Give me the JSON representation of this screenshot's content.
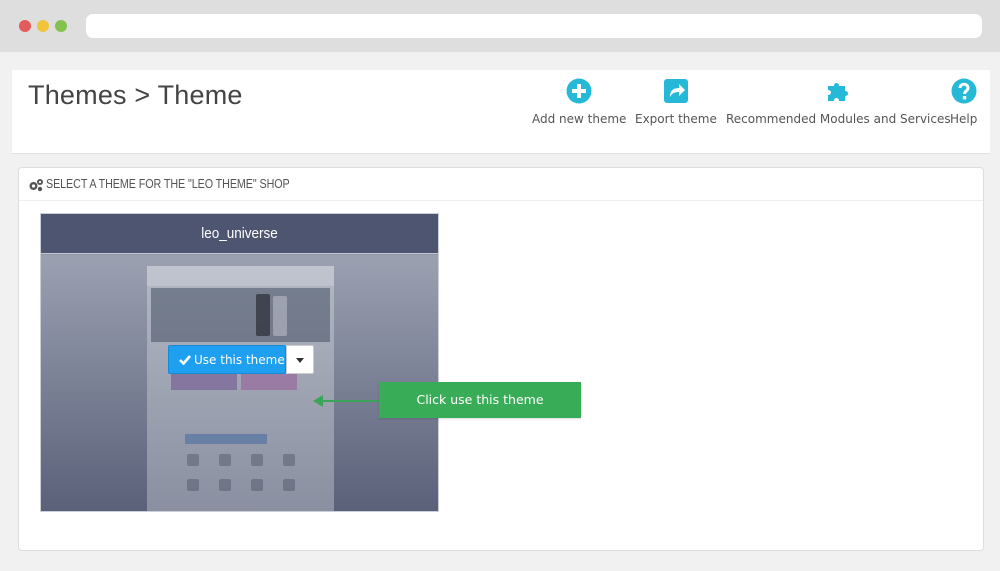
{
  "page": {
    "title": "Themes > Theme"
  },
  "toolbar": {
    "add_new_theme": "Add new theme",
    "export_theme": "Export theme",
    "recommended": "Recommended Modules and Services",
    "help": "Help"
  },
  "panel": {
    "heading": "SELECT A THEME FOR THE \"LEO THEME\" SHOP"
  },
  "theme_card": {
    "name": "leo_universe",
    "use_button_label": "Use this theme"
  },
  "annotation": {
    "callout_text": "Click use this theme"
  },
  "colors": {
    "accent_blue": "#25b9d7",
    "button_blue": "#1f9ff0",
    "callout_green": "#39ac58",
    "theme_header": "#4e5570"
  }
}
